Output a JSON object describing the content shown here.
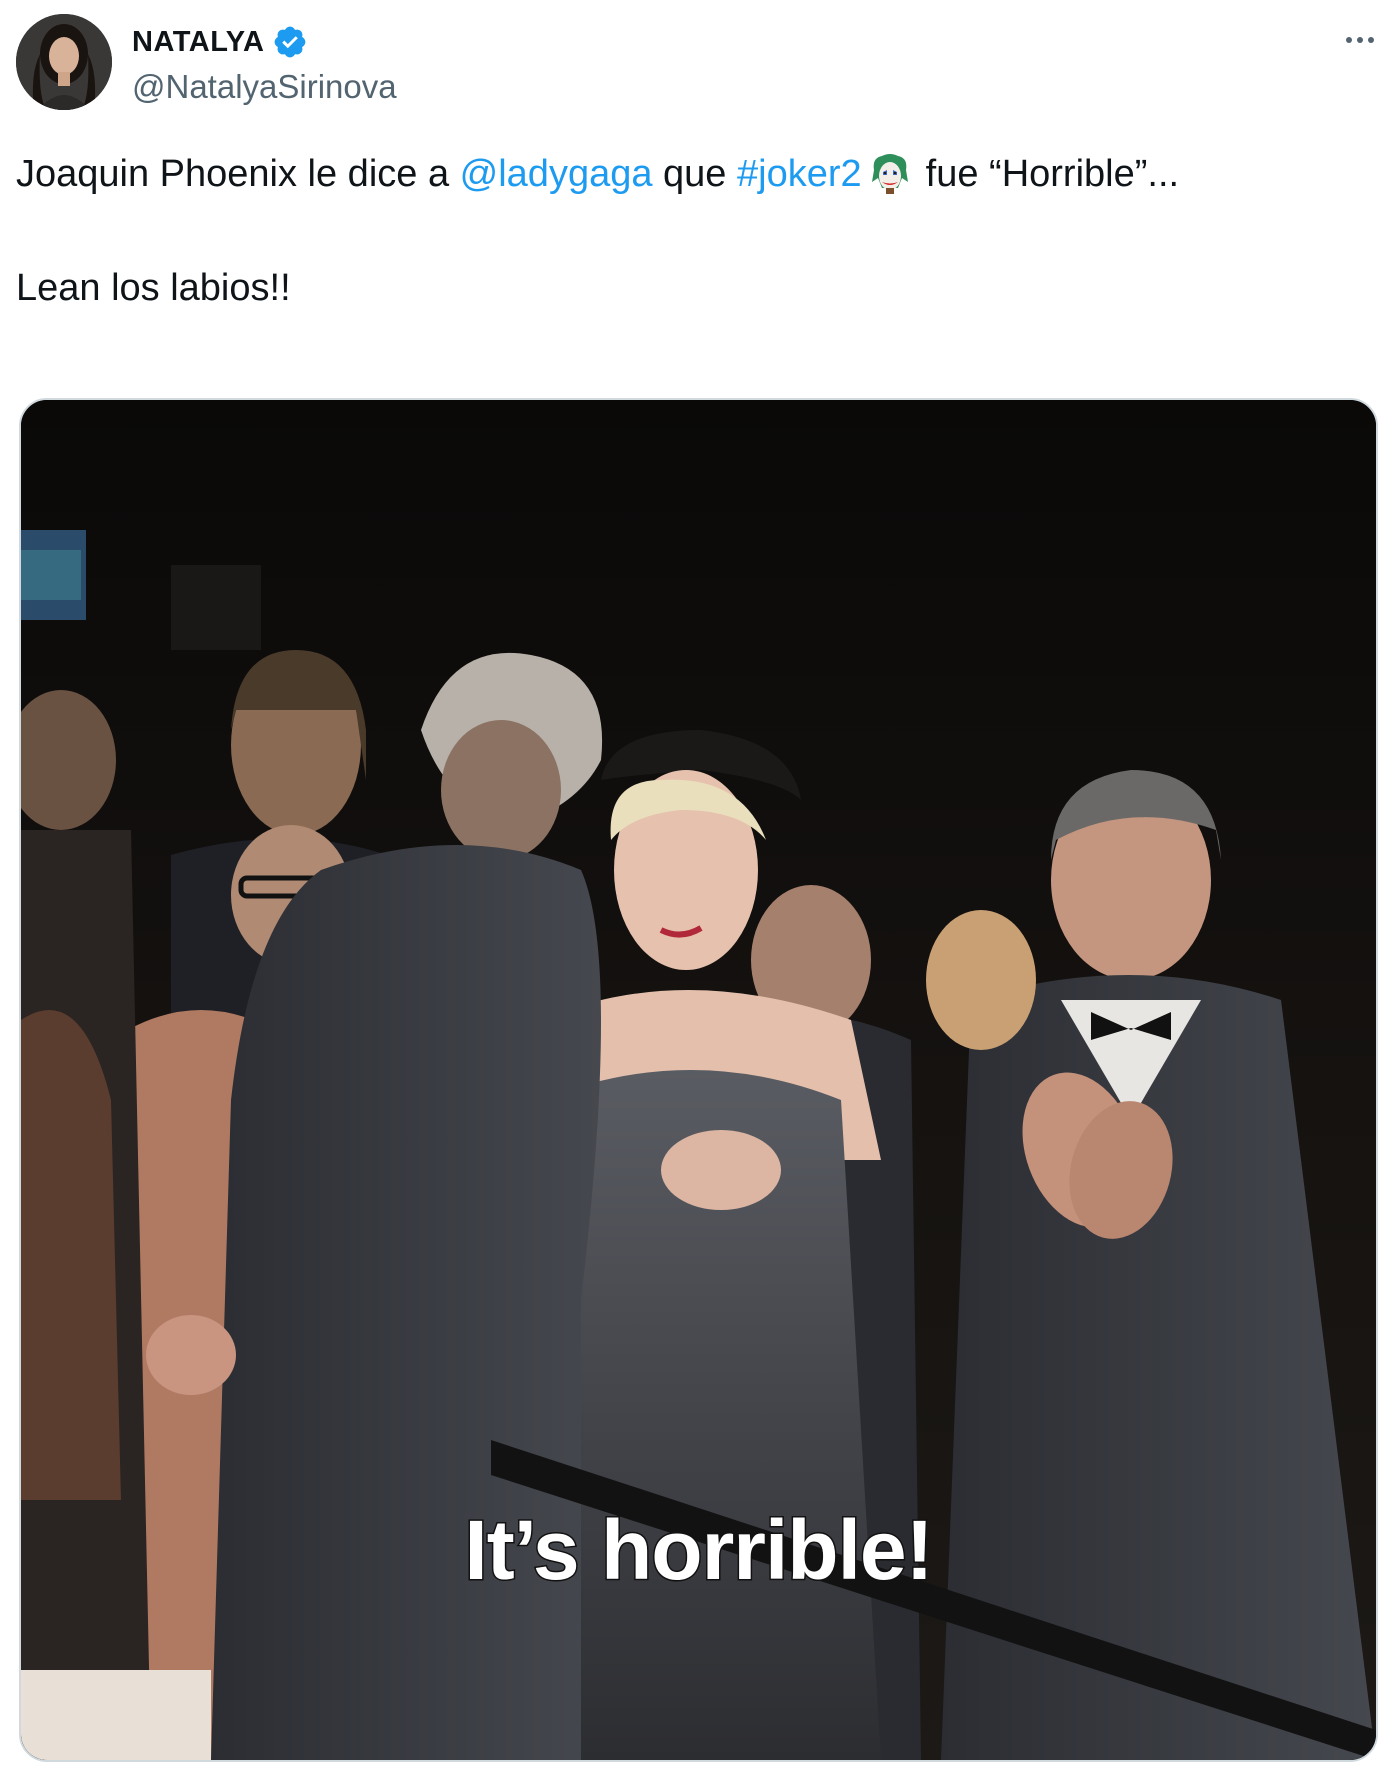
{
  "author": {
    "display_name": "NATALYA",
    "handle": "@NatalyaSirinova",
    "verified": true,
    "avatar_icon": "profile-photo"
  },
  "tweet": {
    "text_part1": "Joaquin Phoenix le dice a ",
    "mention": "@ladygaga",
    "text_part2": " que ",
    "hashtag": "#joker2",
    "emoji_icon": "joker-face-icon",
    "text_part3": "fue “Horrible”...",
    "line2": "Lean los labios!!"
  },
  "media": {
    "type": "video-frame",
    "caption": "It’s horrible!"
  },
  "colors": {
    "link": "#1d9bf0",
    "text": "#0f1419",
    "secondary": "#536471",
    "verified": "#1d9bf0"
  }
}
